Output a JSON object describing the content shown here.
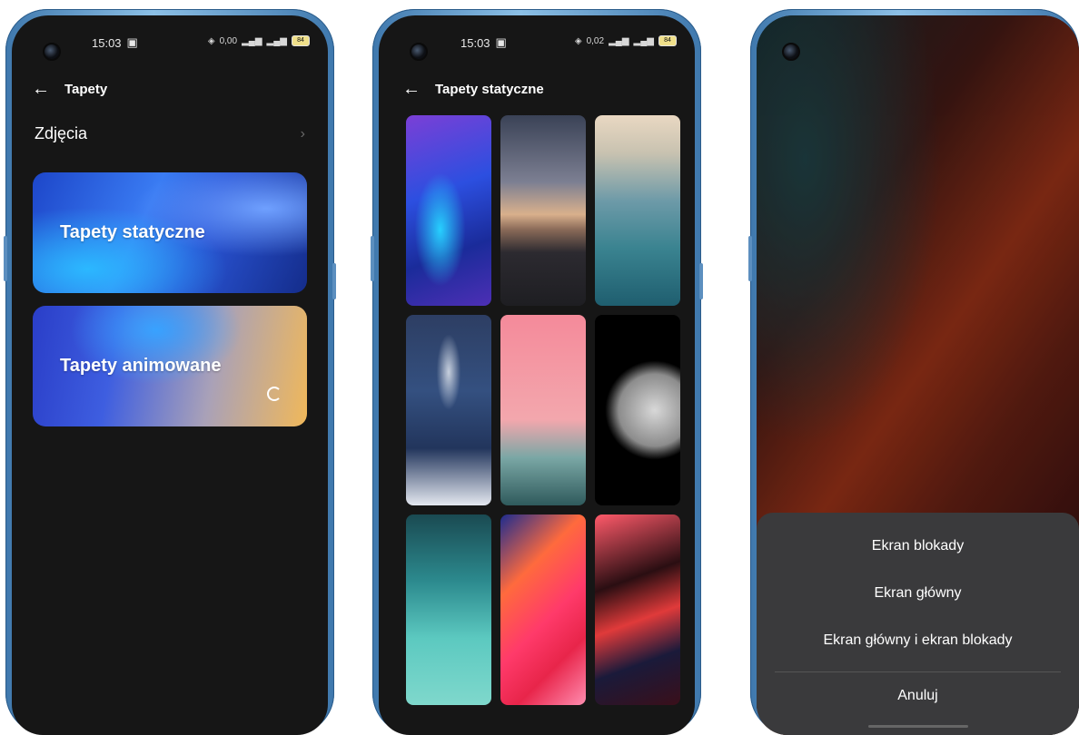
{
  "phone1": {
    "status": {
      "time": "15:03",
      "net_rate": "0,00",
      "battery": "84"
    },
    "title": "Tapety",
    "photos_label": "Zdjęcia",
    "card_static": "Tapety statyczne",
    "card_animated": "Tapety animowane"
  },
  "phone2": {
    "status": {
      "time": "15:03",
      "net_rate": "0,02",
      "battery": "84"
    },
    "title": "Tapety statyczne"
  },
  "phone3": {
    "options": [
      "Ekran blokady",
      "Ekran główny",
      "Ekran główny i ekran blokady"
    ],
    "cancel": "Anuluj"
  },
  "icons": [
    "back-arrow-icon",
    "chevron-right-icon",
    "camera-icon",
    "battery-icon",
    "signal-icon",
    "loading-spinner-icon"
  ]
}
